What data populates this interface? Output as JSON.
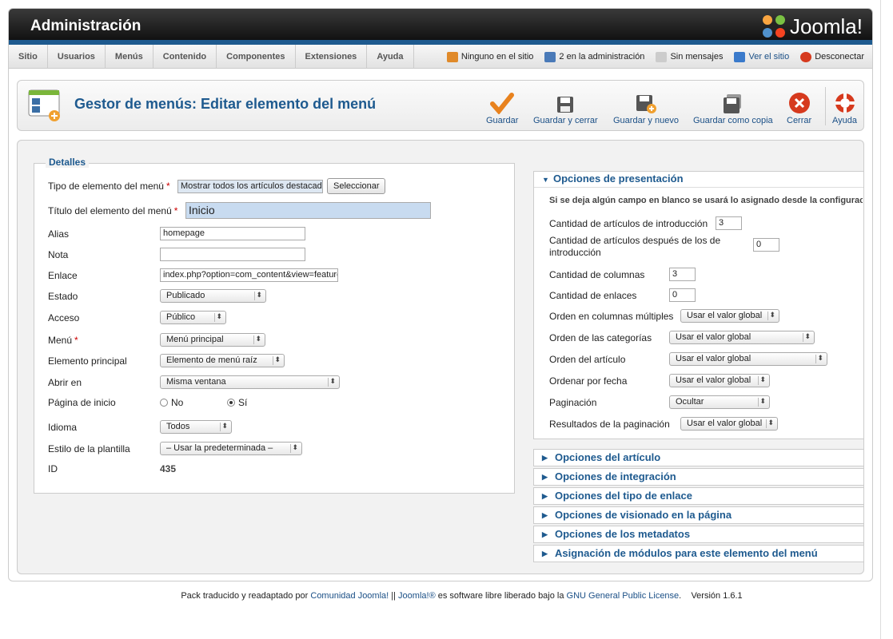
{
  "header": {
    "title": "Administración",
    "logo_text": "Joomla!"
  },
  "menu": {
    "items": [
      "Sitio",
      "Usuarios",
      "Menús",
      "Contenido",
      "Componentes",
      "Extensiones",
      "Ayuda"
    ]
  },
  "status": {
    "site_users": "Ninguno en el sitio",
    "admin_users": "2 en la administración",
    "messages": "Sin mensajes",
    "view_site": "Ver el sitio",
    "logout": "Desconectar"
  },
  "toolbar": {
    "page_title": "Gestor de menús: Editar elemento del menú",
    "buttons": {
      "save": "Guardar",
      "save_close": "Guardar y cerrar",
      "save_new": "Guardar y nuevo",
      "save_copy": "Guardar como copia",
      "close": "Cerrar",
      "help": "Ayuda"
    }
  },
  "details": {
    "legend": "Detalles",
    "type_label": "Tipo de elemento del menú",
    "type_value": "Mostrar todos los artículos destacados",
    "select_button": "Seleccionar",
    "title_label": "Título del elemento del menú",
    "title_value": "Inicio",
    "alias_label": "Alias",
    "alias_value": "homepage",
    "note_label": "Nota",
    "note_value": "",
    "link_label": "Enlace",
    "link_value": "index.php?option=com_content&view=featured",
    "state_label": "Estado",
    "state_value": "Publicado",
    "access_label": "Acceso",
    "access_value": "Público",
    "menu_label": "Menú",
    "menu_value": "Menú principal",
    "parent_label": "Elemento principal",
    "parent_value": "Elemento de menú raíz",
    "open_label": "Abrir en",
    "open_value": "Misma ventana",
    "home_label": "Página de inicio",
    "home_no": "No",
    "home_yes": "Sí",
    "lang_label": "Idioma",
    "lang_value": "Todos",
    "style_label": "Estilo de la plantilla",
    "style_value": "– Usar la predeterminada –",
    "id_label": "ID",
    "id_value": "435"
  },
  "presentation": {
    "title": "Opciones de presentación",
    "note": "Si se deja algún campo en blanco se usará lo asignado desde la configuración global",
    "intro_label": "Cantidad de artículos de introducción",
    "intro_value": "3",
    "after_label": "Cantidad de artículos después de los de introducción",
    "after_value": "0",
    "columns_label": "Cantidad de columnas",
    "columns_value": "3",
    "links_label": "Cantidad de enlaces",
    "links_value": "0",
    "multicol_label": "Orden en columnas múltiples",
    "multicol_value": "Usar el valor global",
    "cat_order_label": "Orden de las categorías",
    "cat_order_value": "Usar el valor global",
    "art_order_label": "Orden del artículo",
    "art_order_value": "Usar el valor global",
    "date_order_label": "Ordenar por fecha",
    "date_order_value": "Usar el valor global",
    "pagination_label": "Paginación",
    "pagination_value": "Ocultar",
    "pag_results_label": "Resultados de la paginación",
    "pag_results_value": "Usar el valor global"
  },
  "panes": [
    "Opciones del artículo",
    "Opciones de integración",
    "Opciones del tipo de enlace",
    "Opciones de visionado en la página",
    "Opciones de los metadatos",
    "Asignación de módulos para este elemento del menú"
  ],
  "footer": {
    "prefix": "Pack traducido y readaptado por ",
    "link1": "Comunidad Joomla!",
    "sep": " || ",
    "link2": "Joomla!®",
    "middle": " es software libre liberado bajo la ",
    "link3": "GNU General Public License",
    "version": ".    Versión 1.6.1"
  },
  "colors": {
    "accent": "#1e5a8f",
    "header_bg": "#1a1a1a",
    "close_red": "#d63a1e",
    "save_orange": "#e8821e"
  }
}
